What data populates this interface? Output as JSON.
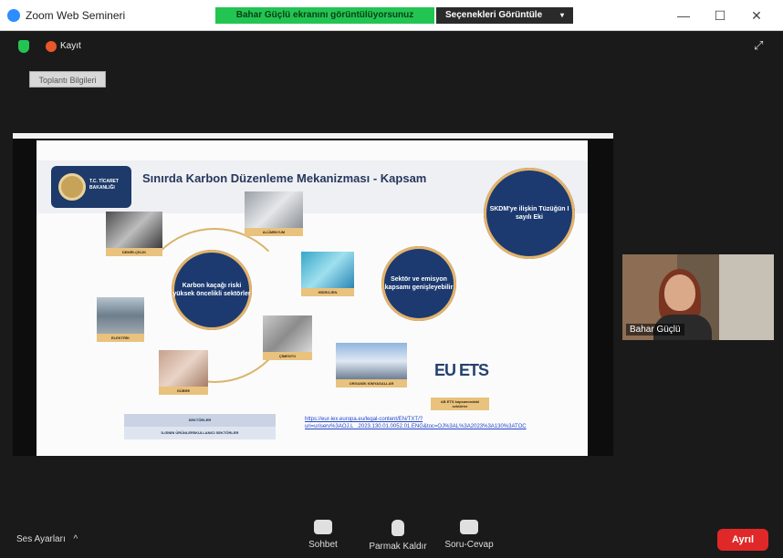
{
  "window": {
    "title": "Zoom Web Semineri",
    "controls": [
      "—",
      "☐",
      "✕"
    ]
  },
  "share_banner": "Bahar Güçlü ekranını görüntülüyorsunuz",
  "view_options": {
    "label": "Seçenekleri Görüntüle",
    "caret": "▾"
  },
  "recording": {
    "label": "Kayıt"
  },
  "meeting_info": "Toplantı Bilgileri",
  "fullscreen_glyph": "⤢",
  "slide": {
    "title": "Sınırda Karbon Düzenleme Mekanizması - Kapsam",
    "ministry_logo_text": "T.C. TİCARET BAKANLIĞI",
    "center_bubble": "Karbon kaçağı riski yüksek öncelikli sektörler",
    "right_bubble_top": "SKDM'ye ilişkin Tüzüğün I sayılı Eki",
    "right_bubble_mid": "Sektör ve emisyon kapsamı genişleyebilir",
    "tiles": [
      {
        "key": "aluminium",
        "caption": "ALÜMİNYUM"
      },
      {
        "key": "hydrogen",
        "caption": "HİDROJEN"
      },
      {
        "key": "iron-steel",
        "caption": "DEMİR-ÇELİK"
      },
      {
        "key": "electricity",
        "caption": "ELEKTRİK"
      },
      {
        "key": "cement",
        "caption": "ÇİMENTO"
      },
      {
        "key": "fertilizer",
        "caption": "GÜBRE"
      },
      {
        "key": "organic-chemistry",
        "caption": "ORGANİK KİMYASALLAR"
      }
    ],
    "eu_ets_logo": "EU ETS",
    "eu_ets_caption": "AB ETS kapsamındaki sektörler",
    "table_rows": [
      "SEKTÖRLER",
      "İLGİNİN ÜRÜNLERİ/KULLANICI SEKTÖRLER"
    ],
    "link_text": "https://eur-lex.europa.eu/legal-content/EN/TXT/?uri=uriserv%3AOJ.L_.2023.130.01.0052.01.ENG&toc=OJ%3AL%3A2023%3A130%3ATOC"
  },
  "participant": {
    "name": "Bahar Güçlü"
  },
  "toolbar": {
    "audio_settings": "Ses Ayarları",
    "audio_caret": "^",
    "chat": "Sohbet",
    "raise_hand": "Parmak Kaldır",
    "qa": "Soru-Cevap",
    "leave": "Ayrıl"
  },
  "colors": {
    "banner_green": "#23c552",
    "slide_navy": "#1c3a70",
    "slide_gold": "#e4b46a",
    "leave_red": "#e02828"
  }
}
